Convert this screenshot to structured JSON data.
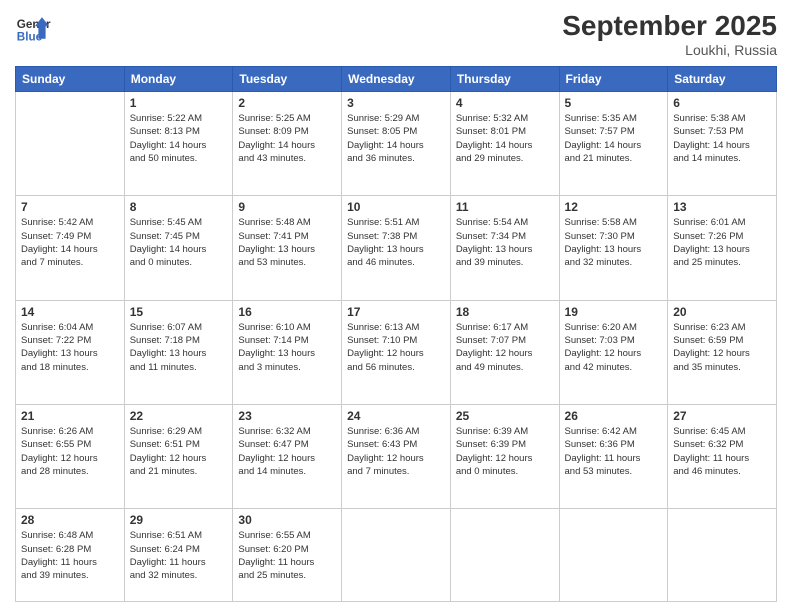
{
  "header": {
    "logo_line1": "General",
    "logo_line2": "Blue",
    "month_title": "September 2025",
    "location": "Loukhi, Russia"
  },
  "days_of_week": [
    "Sunday",
    "Monday",
    "Tuesday",
    "Wednesday",
    "Thursday",
    "Friday",
    "Saturday"
  ],
  "weeks": [
    [
      {
        "num": "",
        "info": ""
      },
      {
        "num": "1",
        "info": "Sunrise: 5:22 AM\nSunset: 8:13 PM\nDaylight: 14 hours\nand 50 minutes."
      },
      {
        "num": "2",
        "info": "Sunrise: 5:25 AM\nSunset: 8:09 PM\nDaylight: 14 hours\nand 43 minutes."
      },
      {
        "num": "3",
        "info": "Sunrise: 5:29 AM\nSunset: 8:05 PM\nDaylight: 14 hours\nand 36 minutes."
      },
      {
        "num": "4",
        "info": "Sunrise: 5:32 AM\nSunset: 8:01 PM\nDaylight: 14 hours\nand 29 minutes."
      },
      {
        "num": "5",
        "info": "Sunrise: 5:35 AM\nSunset: 7:57 PM\nDaylight: 14 hours\nand 21 minutes."
      },
      {
        "num": "6",
        "info": "Sunrise: 5:38 AM\nSunset: 7:53 PM\nDaylight: 14 hours\nand 14 minutes."
      }
    ],
    [
      {
        "num": "7",
        "info": "Sunrise: 5:42 AM\nSunset: 7:49 PM\nDaylight: 14 hours\nand 7 minutes."
      },
      {
        "num": "8",
        "info": "Sunrise: 5:45 AM\nSunset: 7:45 PM\nDaylight: 14 hours\nand 0 minutes."
      },
      {
        "num": "9",
        "info": "Sunrise: 5:48 AM\nSunset: 7:41 PM\nDaylight: 13 hours\nand 53 minutes."
      },
      {
        "num": "10",
        "info": "Sunrise: 5:51 AM\nSunset: 7:38 PM\nDaylight: 13 hours\nand 46 minutes."
      },
      {
        "num": "11",
        "info": "Sunrise: 5:54 AM\nSunset: 7:34 PM\nDaylight: 13 hours\nand 39 minutes."
      },
      {
        "num": "12",
        "info": "Sunrise: 5:58 AM\nSunset: 7:30 PM\nDaylight: 13 hours\nand 32 minutes."
      },
      {
        "num": "13",
        "info": "Sunrise: 6:01 AM\nSunset: 7:26 PM\nDaylight: 13 hours\nand 25 minutes."
      }
    ],
    [
      {
        "num": "14",
        "info": "Sunrise: 6:04 AM\nSunset: 7:22 PM\nDaylight: 13 hours\nand 18 minutes."
      },
      {
        "num": "15",
        "info": "Sunrise: 6:07 AM\nSunset: 7:18 PM\nDaylight: 13 hours\nand 11 minutes."
      },
      {
        "num": "16",
        "info": "Sunrise: 6:10 AM\nSunset: 7:14 PM\nDaylight: 13 hours\nand 3 minutes."
      },
      {
        "num": "17",
        "info": "Sunrise: 6:13 AM\nSunset: 7:10 PM\nDaylight: 12 hours\nand 56 minutes."
      },
      {
        "num": "18",
        "info": "Sunrise: 6:17 AM\nSunset: 7:07 PM\nDaylight: 12 hours\nand 49 minutes."
      },
      {
        "num": "19",
        "info": "Sunrise: 6:20 AM\nSunset: 7:03 PM\nDaylight: 12 hours\nand 42 minutes."
      },
      {
        "num": "20",
        "info": "Sunrise: 6:23 AM\nSunset: 6:59 PM\nDaylight: 12 hours\nand 35 minutes."
      }
    ],
    [
      {
        "num": "21",
        "info": "Sunrise: 6:26 AM\nSunset: 6:55 PM\nDaylight: 12 hours\nand 28 minutes."
      },
      {
        "num": "22",
        "info": "Sunrise: 6:29 AM\nSunset: 6:51 PM\nDaylight: 12 hours\nand 21 minutes."
      },
      {
        "num": "23",
        "info": "Sunrise: 6:32 AM\nSunset: 6:47 PM\nDaylight: 12 hours\nand 14 minutes."
      },
      {
        "num": "24",
        "info": "Sunrise: 6:36 AM\nSunset: 6:43 PM\nDaylight: 12 hours\nand 7 minutes."
      },
      {
        "num": "25",
        "info": "Sunrise: 6:39 AM\nSunset: 6:39 PM\nDaylight: 12 hours\nand 0 minutes."
      },
      {
        "num": "26",
        "info": "Sunrise: 6:42 AM\nSunset: 6:36 PM\nDaylight: 11 hours\nand 53 minutes."
      },
      {
        "num": "27",
        "info": "Sunrise: 6:45 AM\nSunset: 6:32 PM\nDaylight: 11 hours\nand 46 minutes."
      }
    ],
    [
      {
        "num": "28",
        "info": "Sunrise: 6:48 AM\nSunset: 6:28 PM\nDaylight: 11 hours\nand 39 minutes."
      },
      {
        "num": "29",
        "info": "Sunrise: 6:51 AM\nSunset: 6:24 PM\nDaylight: 11 hours\nand 32 minutes."
      },
      {
        "num": "30",
        "info": "Sunrise: 6:55 AM\nSunset: 6:20 PM\nDaylight: 11 hours\nand 25 minutes."
      },
      {
        "num": "",
        "info": ""
      },
      {
        "num": "",
        "info": ""
      },
      {
        "num": "",
        "info": ""
      },
      {
        "num": "",
        "info": ""
      }
    ]
  ]
}
